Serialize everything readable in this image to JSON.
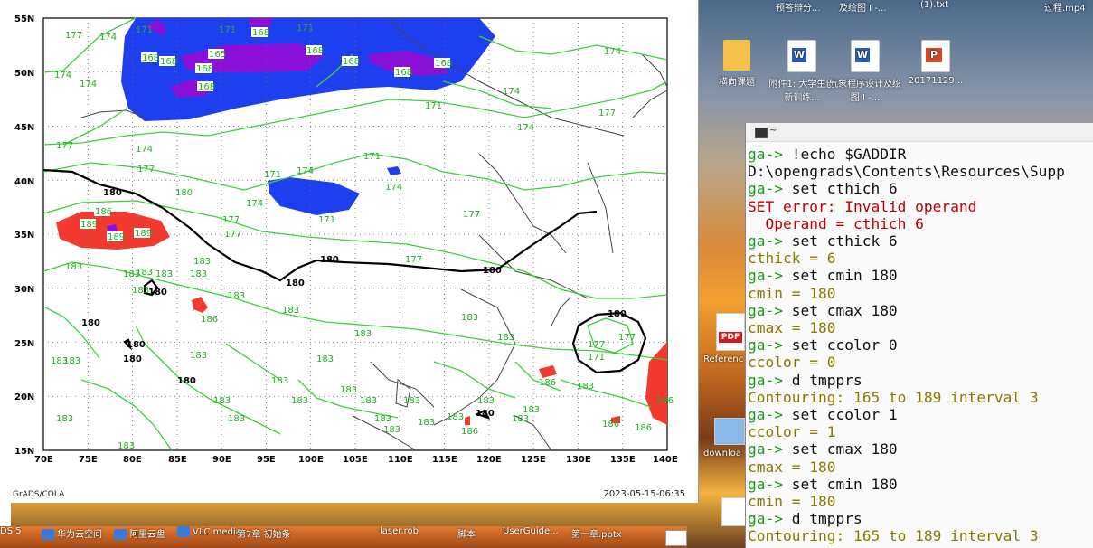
{
  "grads_window": {
    "footer_left": "GrADS/COLA",
    "footer_right": "2023-05-15-06:35",
    "lat_labels": [
      "55N",
      "50N",
      "45N",
      "40N",
      "35N",
      "30N",
      "25N",
      "20N",
      "15N"
    ],
    "lon_labels": [
      "70E",
      "75E",
      "80E",
      "85E",
      "90E",
      "95E",
      "100E",
      "105E",
      "110E",
      "115E",
      "120E",
      "125E",
      "130E",
      "135E",
      "140E"
    ],
    "colors": {
      "blue_fill": "#1e3ff0",
      "purple_fill": "#8a10d8",
      "red_fill": "#f23a30",
      "contour_green": "#3ad23a",
      "contour_black": "#000000"
    }
  },
  "desktop": {
    "top_labels": [
      "预答辩分...",
      "及绘图 I -...",
      "(1).txt",
      "过程.mp4"
    ],
    "icons": [
      {
        "name": "横向课题",
        "type": "folder"
      },
      {
        "name": "附件1: 大学生创新训练...",
        "type": "word"
      },
      {
        "name": "气象程序设计及绘图 I -...",
        "type": "word"
      },
      {
        "name": "20171129...",
        "type": "ppt"
      }
    ],
    "side_labels": {
      "pdf": "Referenc",
      "download": "downloa"
    }
  },
  "terminal": {
    "title": "~",
    "lines": [
      {
        "kind": "prompt",
        "prefix": "ga-> ",
        "text": "!echo $GADDIR"
      },
      {
        "kind": "plain",
        "text": "D:\\opengrads\\Contents\\Resources\\Supp"
      },
      {
        "kind": "prompt",
        "prefix": "ga-> ",
        "text": "set cthich 6"
      },
      {
        "kind": "err",
        "text": "SET error: Invalid operand"
      },
      {
        "kind": "err",
        "text": "  Operand = cthich 6"
      },
      {
        "kind": "prompt",
        "prefix": "ga-> ",
        "text": "set cthick 6"
      },
      {
        "kind": "out",
        "text": "cthick = 6"
      },
      {
        "kind": "prompt",
        "prefix": "ga-> ",
        "text": "set cmin 180"
      },
      {
        "kind": "out",
        "text": "cmin = 180"
      },
      {
        "kind": "prompt",
        "prefix": "ga-> ",
        "text": "set cmax 180"
      },
      {
        "kind": "out",
        "text": "cmax = 180"
      },
      {
        "kind": "prompt",
        "prefix": "ga-> ",
        "text": "set ccolor 0"
      },
      {
        "kind": "out",
        "text": "ccolor = 0"
      },
      {
        "kind": "prompt",
        "prefix": "ga-> ",
        "text": "d tmpprs"
      },
      {
        "kind": "out",
        "text": "Contouring: 165 to 189 interval 3"
      },
      {
        "kind": "prompt",
        "prefix": "ga-> ",
        "text": "set ccolor 1"
      },
      {
        "kind": "out",
        "text": "ccolor = 1"
      },
      {
        "kind": "prompt",
        "prefix": "ga-> ",
        "text": "set cmax 180"
      },
      {
        "kind": "out",
        "text": "cmax = 180"
      },
      {
        "kind": "prompt",
        "prefix": "ga-> ",
        "text": "set cmin 180"
      },
      {
        "kind": "out",
        "text": "cmin = 180"
      },
      {
        "kind": "prompt",
        "prefix": "ga-> ",
        "text": "d tmpprs"
      },
      {
        "kind": "out",
        "text": "Contouring: 165 to 189 interval 3"
      }
    ]
  },
  "taskbar": {
    "items": [
      "DS 5",
      "华为云空间",
      "阿里云盘",
      "VLC media",
      "第7章 初始条",
      "laser.rob",
      "脚本",
      "UserGuide...",
      "第一章.pptx"
    ]
  }
}
